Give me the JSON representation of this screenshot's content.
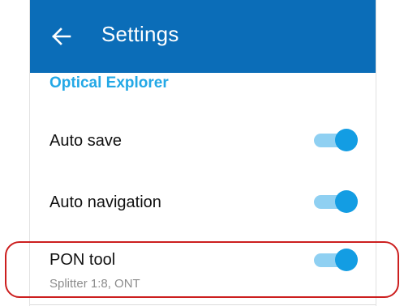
{
  "header": {
    "title": "Settings",
    "background_color": "#0b6db8",
    "back_icon": "arrow-left-icon"
  },
  "section": {
    "title": "Optical Explorer",
    "color": "#23a8e6"
  },
  "settings": [
    {
      "label": "Auto save",
      "subtitle": "",
      "enabled": true
    },
    {
      "label": "Auto navigation",
      "subtitle": "",
      "enabled": true
    },
    {
      "label": "PON tool",
      "subtitle": "Splitter 1:8, ONT",
      "enabled": true
    }
  ],
  "colors": {
    "toggle_knob": "#139de3",
    "toggle_track": "#8fd0f2",
    "highlight_outline": "#cc1f1f"
  }
}
